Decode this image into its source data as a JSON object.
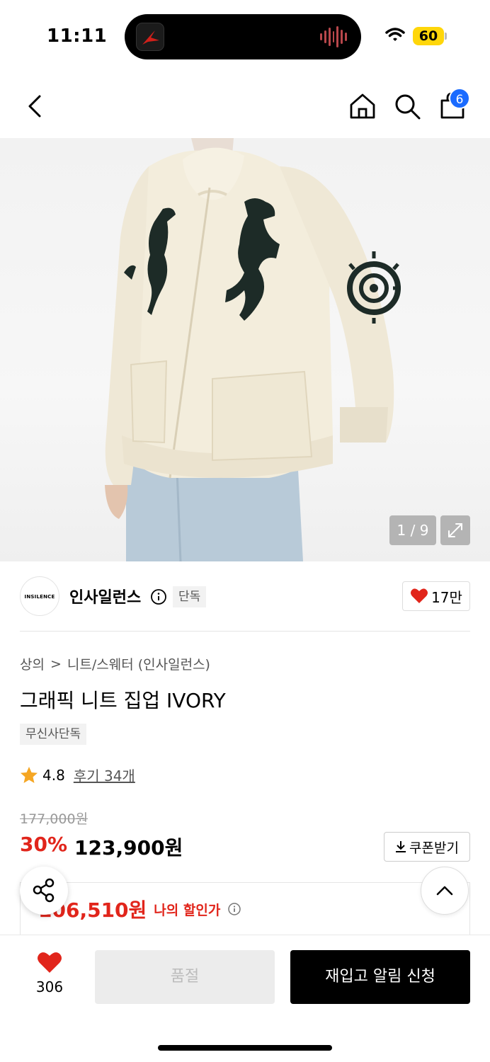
{
  "status_bar": {
    "time": "11:11",
    "battery": "60"
  },
  "header": {
    "cart_count": "6"
  },
  "gallery": {
    "counter": "1 / 9"
  },
  "brand": {
    "logo_text": "INSILENCE",
    "name": "인사일런스",
    "exclusive_tag": "단독",
    "likes": "17만"
  },
  "breadcrumb": {
    "category": "상의",
    "separator": ">",
    "subcategory": "니트/스웨터 (인사일런스)"
  },
  "product": {
    "title": "그래픽 니트 집업 IVORY",
    "tag": "무신사단독",
    "rating": "4.8",
    "reviews": "후기 34개",
    "original_price": "177,000원",
    "discount_rate": "30%",
    "sale_price": "123,900원",
    "coupon_label": "쿠폰받기",
    "my_price": "106,510원",
    "my_price_label": "나의 할인가"
  },
  "bottom": {
    "wish_count": "306",
    "soldout_label": "품절",
    "restock_label": "재입고 알림 신청"
  },
  "colors": {
    "accent_red": "#e1251b",
    "badge_blue": "#1a6bff",
    "battery_yellow": "#ffd60a"
  }
}
